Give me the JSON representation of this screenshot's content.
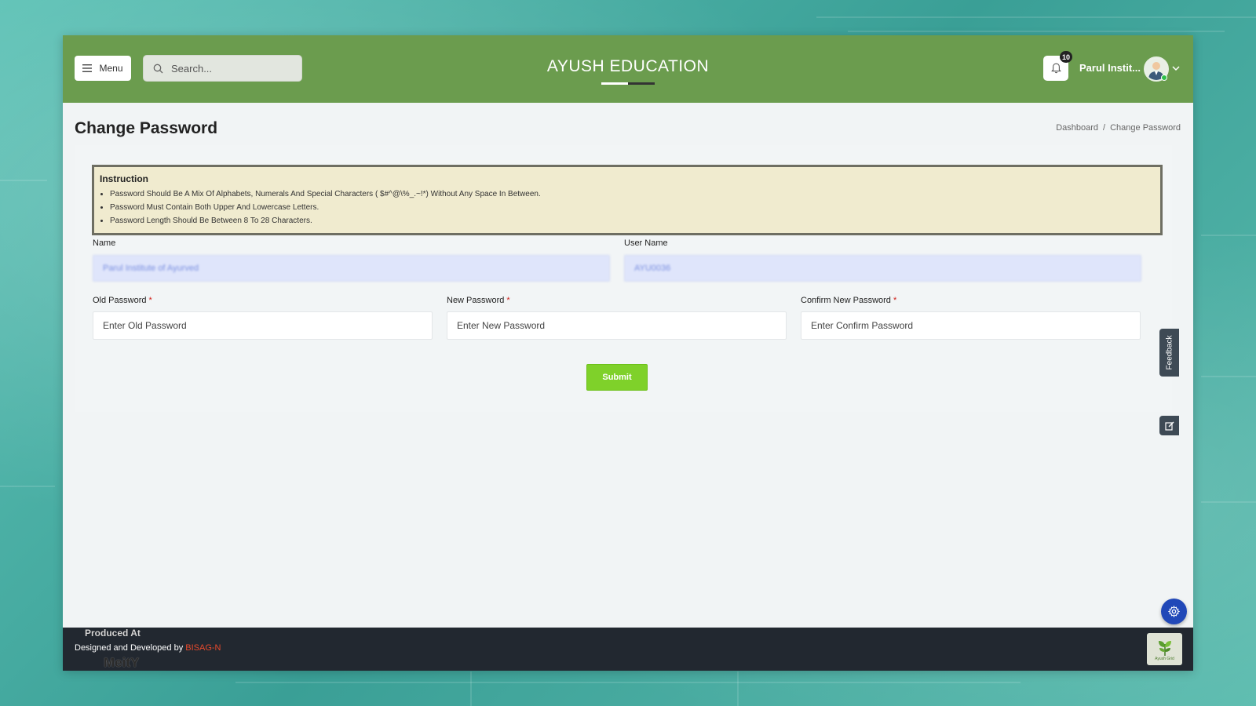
{
  "header": {
    "menu_label": "Menu",
    "search_placeholder": "Search...",
    "title": "AYUSH EDUCATION",
    "notification_count": "10",
    "user_name": "Parul Instit..."
  },
  "page": {
    "title": "Change Password",
    "breadcrumb": [
      "Dashboard",
      "/",
      "Change Password"
    ]
  },
  "instruction": {
    "heading": "Instruction",
    "items": [
      "Password Should Be A Mix Of Alphabets, Numerals And Special Characters ( $#^@\\%_.~!*) Without Any Space In Between.",
      "Password Must Contain Both Upper And Lowercase Letters.",
      "Password Length Should Be Between 8 To 28 Characters."
    ]
  },
  "form": {
    "name_label": "Name",
    "name_value": "Parul Institute of Ayurved",
    "username_label": "User Name",
    "username_value": "AYU0036",
    "old_password_label": "Old Password",
    "old_password_placeholder": "Enter Old Password",
    "new_password_label": "New Password",
    "new_password_placeholder": "Enter New Password",
    "confirm_password_label": "Confirm New Password",
    "confirm_password_placeholder": "Enter Confirm Password",
    "required_mark": "*",
    "submit_label": "Submit"
  },
  "side": {
    "feedback_label": "Feedback"
  },
  "footer": {
    "prefix": "Designed and Developed by ",
    "developer": "BISAG-N",
    "produced_at": "Produced At",
    "meity": "MeitY",
    "logo_caption": "Ayush Grid"
  },
  "colors": {
    "header_green": "#6b9c4e",
    "submit_green": "#7fd12a",
    "instruction_bg": "#f0ebcf",
    "footer_bg": "#222830",
    "fab_blue": "#2148b8"
  }
}
